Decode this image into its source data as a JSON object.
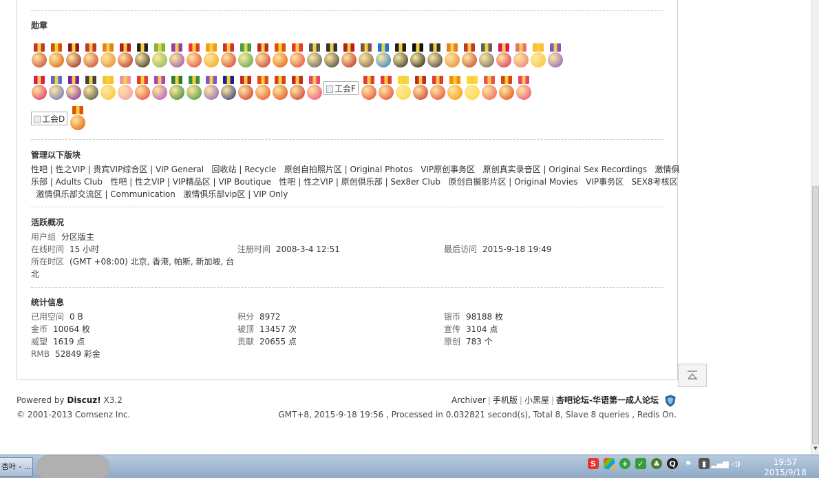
{
  "medals_section": {
    "title": "勋章",
    "broken_images": [
      "工会F",
      "工会D"
    ],
    "row1_colors": [
      "#c0392b",
      "#d35400",
      "#8e1a1a",
      "#c0392b",
      "#e67e22",
      "#b71c1c",
      "#222222",
      "#7cb342",
      "#8e44ad",
      "#e53935",
      "#f39c12",
      "#d32f2f",
      "#43a047",
      "#c62828",
      "#e65100",
      "#e53935",
      "#555555",
      "#333333",
      "#b71c1c",
      "#795548",
      "#1976d2",
      "#222222",
      "#111111",
      "#333333",
      "#e67e22",
      "#c0392b",
      "#616161",
      "#d81b60",
      "#e57373",
      "#fbc02d",
      "#7e57c2"
    ],
    "row2_colors": [
      "#d81b60",
      "#5c6bc0",
      "#7b1fa2",
      "#424242",
      "#fbc02d",
      "#f48fb1",
      "#e53935",
      "#ab47bc",
      "#2e7d32",
      "#388e3c",
      "#7e57c2",
      "#1a237e",
      "#c62828",
      "#e64a19",
      "#d84315",
      "#c62828",
      "#ec407a",
      "#e53935",
      "#e53935",
      "#fdd835",
      "#c62828",
      "#e53935",
      "#fb8c00",
      "#fdd835",
      "#ef5350",
      "#d84315",
      "#ec407a"
    ],
    "row3_colors": [
      "#e65100"
    ]
  },
  "managed_section": {
    "title": "管理以下版块",
    "lines": [
      "性吧 | 性之VIP | 贵宾VIP综合区 | VIP General   回收站 | Recycle   原创自拍照片区 | Original Photos   VIP原创事务区   原创真实录音区 | Original Sex Recordings   激情俱",
      "乐部 | Adults Club   性吧 | 性之VIP | VIP精品区 | VIP Boutique   性吧 | 性之VIP | 原创俱乐部 | Sex8er Club   原创自摄影片区 | Original Movies   VIP事务区   SEX8考核区",
      "  激情俱乐部交流区 | Communication   激情俱乐部vip区 | VIP Only"
    ]
  },
  "activity_section": {
    "title": "活跃概况",
    "user_group_label": "用户组",
    "user_group_value": "分区版主",
    "online_label": "在线时间",
    "online_value": "15 小时",
    "register_label": "注册时间",
    "register_value": "2008-3-4 12:51",
    "last_visit_label": "最后访问",
    "last_visit_value": "2015-9-18 19:49",
    "timezone_label": "所在时区",
    "timezone_value": "(GMT +08:00) 北京, 香港, 帕斯, 新加坡, 台北"
  },
  "stats_section": {
    "title": "统计信息",
    "space_label": "已用空间",
    "space_value": "0 B",
    "points_label": "积分",
    "points_value": "8972",
    "silver_label": "银币",
    "silver_value": "98188 枚",
    "gold_label": "金币",
    "gold_value": "10064 枚",
    "topped_label": "被顶",
    "topped_value": "13457 次",
    "promo_label": "宣传",
    "promo_value": "3104 点",
    "prestige_label": "威望",
    "prestige_value": "1619 点",
    "contrib_label": "贡献",
    "contrib_value": "20655 点",
    "original_label": "原创",
    "original_value": "783 个",
    "rmb_label": "RMB",
    "rmb_value": "52849 彩金"
  },
  "footer": {
    "powered_prefix": "Powered by ",
    "powered_brand": "Discuz!",
    "powered_version": " X3.2",
    "copyright": "© 2001-2013 Comsenz Inc.",
    "links": [
      "Archiver",
      "手机版",
      "小黑屋"
    ],
    "site_name": "杏吧论坛-华语第一成人论坛",
    "stats_line": "GMT+8, 2015-9-18 19:56 , Processed in 0.032821 second(s), Total 8, Slave 8 queries , Redis On."
  },
  "taskbar": {
    "task_label": "杏叶 - ...",
    "clock_time": "19:57",
    "clock_date": "2015/9/18",
    "tray_icons": [
      "sogou-ime-icon",
      "windows-flag-icon",
      "360-security-icon",
      "shield-icon",
      "tree-icon",
      "qq-icon",
      "flag-icon",
      "usb-icon",
      "network-icon",
      "volume-icon"
    ]
  }
}
